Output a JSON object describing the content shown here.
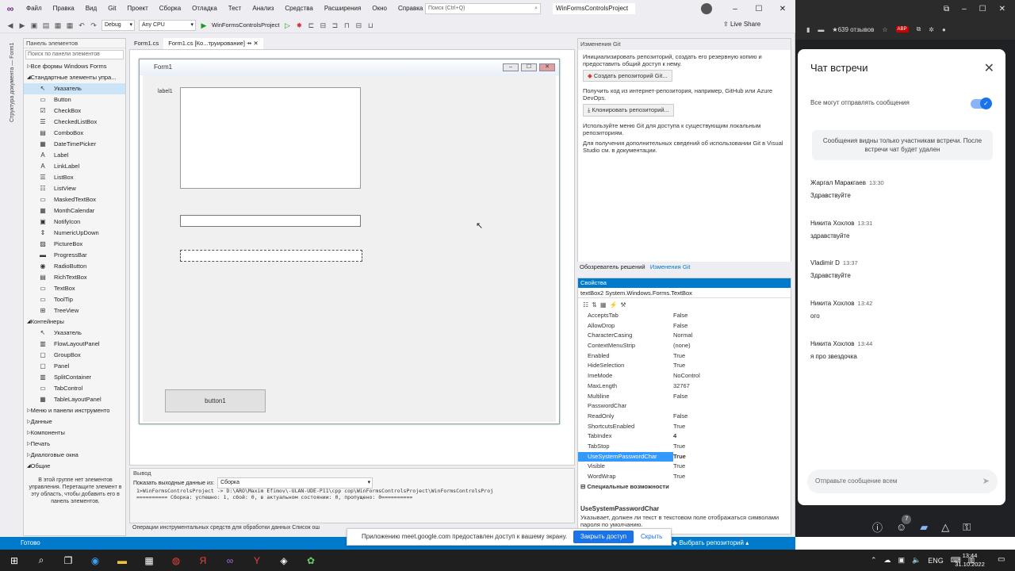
{
  "menubar": {
    "items": [
      "Файл",
      "Правка",
      "Вид",
      "Git",
      "Проект",
      "Сборка",
      "Отладка",
      "Тест",
      "Анализ",
      "Средства",
      "Расширения",
      "Окно",
      "Справка"
    ],
    "search_placeholder": "Поиск (Ctrl+Q)",
    "project_name": "WinFormsControlsProject"
  },
  "toolbar": {
    "config": "Debug",
    "platform": "Any CPU",
    "run_target": "WinFormsControlsProject",
    "live_share": "Live Share"
  },
  "side_strip": "Структура документа — Form1",
  "toolbox": {
    "header": "Панель элементов",
    "search_placeholder": "Поиск по панели элементов",
    "items": [
      {
        "label": "Все формы Windows Forms",
        "type": "group"
      },
      {
        "label": "Стандартные элементы упра...",
        "type": "group"
      },
      {
        "label": "Указатель",
        "icon": "↖",
        "selected": true
      },
      {
        "label": "Button",
        "icon": "▭"
      },
      {
        "label": "CheckBox",
        "icon": "☑"
      },
      {
        "label": "CheckedListBox",
        "icon": "☰"
      },
      {
        "label": "ComboBox",
        "icon": "▤"
      },
      {
        "label": "DateTimePicker",
        "icon": "▦"
      },
      {
        "label": "Label",
        "icon": "A"
      },
      {
        "label": "LinkLabel",
        "icon": "A"
      },
      {
        "label": "ListBox",
        "icon": "☰"
      },
      {
        "label": "ListView",
        "icon": "☷"
      },
      {
        "label": "MaskedTextBox",
        "icon": "▭"
      },
      {
        "label": "MonthCalendar",
        "icon": "▦"
      },
      {
        "label": "NotifyIcon",
        "icon": "▣"
      },
      {
        "label": "NumericUpDown",
        "icon": "⇕"
      },
      {
        "label": "PictureBox",
        "icon": "▨"
      },
      {
        "label": "ProgressBar",
        "icon": "▬"
      },
      {
        "label": "RadioButton",
        "icon": "◉"
      },
      {
        "label": "RichTextBox",
        "icon": "▤"
      },
      {
        "label": "TextBox",
        "icon": "▭"
      },
      {
        "label": "ToolTip",
        "icon": "▭"
      },
      {
        "label": "TreeView",
        "icon": "⊞"
      },
      {
        "label": "Контейнеры",
        "type": "group"
      },
      {
        "label": "Указатель",
        "icon": "↖"
      },
      {
        "label": "FlowLayoutPanel",
        "icon": "▥"
      },
      {
        "label": "GroupBox",
        "icon": "▢"
      },
      {
        "label": "Panel",
        "icon": "▢"
      },
      {
        "label": "SplitContainer",
        "icon": "▥"
      },
      {
        "label": "TabControl",
        "icon": "▭"
      },
      {
        "label": "TableLayoutPanel",
        "icon": "▦"
      },
      {
        "label": "Меню и панели инструменто",
        "type": "group"
      },
      {
        "label": "Данные",
        "type": "group"
      },
      {
        "label": "Компоненты",
        "type": "group"
      },
      {
        "label": "Печать",
        "type": "group"
      },
      {
        "label": "Диалоговые окна",
        "type": "group"
      },
      {
        "label": "Общие",
        "type": "group"
      }
    ],
    "description": "В этой группе нет элементов управления. Перетащите элемент в эту область, чтобы добавить его в панель элементов."
  },
  "doc_tabs": [
    "Form1.cs",
    "Form1.cs [Ко...труирование]"
  ],
  "form": {
    "title": "Form1",
    "label1": "label1",
    "button1": "button1"
  },
  "output": {
    "header": "Вывод",
    "source_label": "Показать выходные данные из:",
    "source_value": "Сборка",
    "lines": [
      "1>WinFormsControlsProject -> D:\\ARO\\Maxim Efimov\\-ULAN-UDE-P11\\cpp cop\\WinFormsControlsProject\\WinFormsControlsProj",
      "========== Сборка: успешно: 1, сбой: 0, в актуальном состоянии: 0, пропущено: 0=========="
    ],
    "bottom_tabs": "Операции инструментальных средств для обработки данных    Список ош"
  },
  "git": {
    "header": "Изменения Git",
    "p1": "Инициализировать репозиторий, создать его резервную копию и предоставить общий доступ к нему.",
    "btn_create": "Создать репозиторий Git...",
    "p2": "Получить код из интернет-репозитория, например, GitHub или Azure DevOps.",
    "btn_clone": "Клонировать репозиторий...",
    "p3": "Используйте меню Git для доступа к существующим локальным репозиториям.",
    "p4": "Для получения дополнительных сведений об использовании Git в Visual Studio см. в документации.",
    "tab1": "Обозреватель решений",
    "tab2": "Изменения Git"
  },
  "properties": {
    "header": "Свойства",
    "object": "textBox2  System.Windows.Forms.TextBox",
    "rows": [
      {
        "name": "AcceptsTab",
        "value": "False"
      },
      {
        "name": "AllowDrop",
        "value": "False"
      },
      {
        "name": "CharacterCasing",
        "value": "Normal"
      },
      {
        "name": "ContextMenuStrip",
        "value": "(none)"
      },
      {
        "name": "Enabled",
        "value": "True"
      },
      {
        "name": "HideSelection",
        "value": "True"
      },
      {
        "name": "ImeMode",
        "value": "NoControl"
      },
      {
        "name": "MaxLength",
        "value": "32767"
      },
      {
        "name": "Multiline",
        "value": "False"
      },
      {
        "name": "PasswordChar",
        "value": ""
      },
      {
        "name": "ReadOnly",
        "value": "False"
      },
      {
        "name": "ShortcutsEnabled",
        "value": "True"
      },
      {
        "name": "TabIndex",
        "value": "4"
      },
      {
        "name": "TabStop",
        "value": "True"
      },
      {
        "name": "UseSystemPasswordChar",
        "value": "True",
        "selected": true
      },
      {
        "name": "Visible",
        "value": "True"
      },
      {
        "name": "WordWrap",
        "value": "True"
      }
    ],
    "category": "Специальные возможности",
    "desc_title": "UseSystemPasswordChar",
    "desc_text": "Указывает, должен ли текст в текстовом поле отображаться символами пароля по умолчанию."
  },
  "status": {
    "ready": "Готово",
    "repo": "Выбрать репозиторий"
  },
  "notice": {
    "text": "Приложению meet.google.com предоставлен доступ к вашему экрану.",
    "stop": "Закрыть доступ",
    "hide": "Скрыть"
  },
  "browser": {
    "bookmark": "639 отзывов",
    "abp": "ABP"
  },
  "chat": {
    "title": "Чат встречи",
    "toggle_label": "Все могут отправлять сообщения",
    "info": "Сообщения видны только участникам встречи. После встречи чат будет удален",
    "messages": [
      {
        "who": "Жаргал Маракгаев",
        "time": "13:30",
        "text": "Здравствуйте"
      },
      {
        "who": "Никита Хохлов",
        "time": "13:31",
        "text": "здравствуйте"
      },
      {
        "who": "Vladimir D",
        "time": "13:37",
        "text": "Здравствуйте"
      },
      {
        "who": "Никита Хохлов",
        "time": "13:42",
        "text": "ого"
      },
      {
        "who": "Никита Хохлов",
        "time": "13:44",
        "text": "я про звездочка"
      }
    ],
    "input_placeholder": "Отправьте сообщение всем",
    "participants_count": "7"
  },
  "taskbar": {
    "lang": "ENG",
    "time": "13:44",
    "date": "31.10.2022"
  },
  "colors": {
    "accent": "#007acc",
    "meet_blue": "#1a73e8"
  }
}
